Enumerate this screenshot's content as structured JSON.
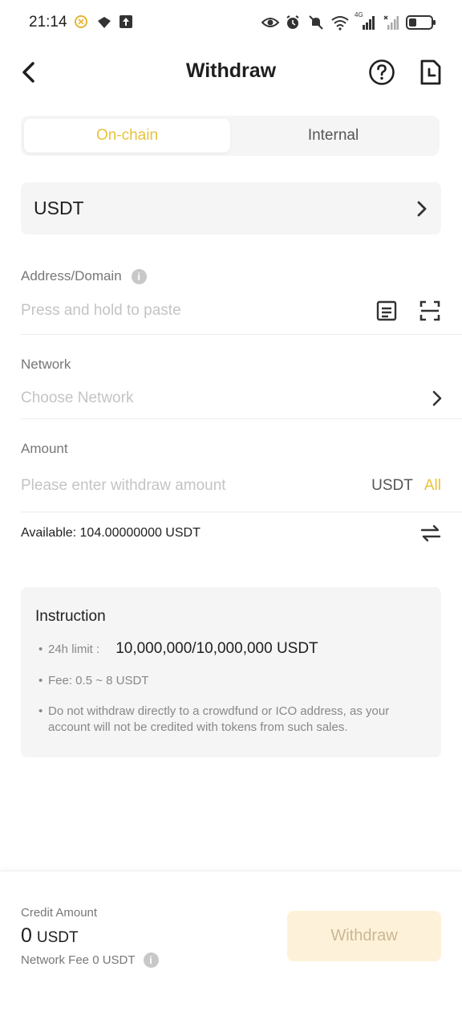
{
  "status_bar": {
    "time": "21:14",
    "network_label": "4G"
  },
  "header": {
    "title": "Withdraw"
  },
  "tabs": [
    {
      "label": "On-chain",
      "active": true
    },
    {
      "label": "Internal",
      "active": false
    }
  ],
  "coin": {
    "symbol": "USDT"
  },
  "address": {
    "label": "Address/Domain",
    "placeholder": "Press and hold to paste"
  },
  "network": {
    "label": "Network",
    "placeholder": "Choose Network"
  },
  "amount": {
    "label": "Amount",
    "placeholder": "Please enter withdraw amount",
    "unit": "USDT",
    "all_label": "All"
  },
  "available": {
    "text": "Available: 104.00000000 USDT"
  },
  "instruction": {
    "title": "Instruction",
    "limit_label": "24h limit :",
    "limit_value": "10,000,000/10,000,000 USDT",
    "fee_text": "Fee: 0.5 ~ 8 USDT",
    "note": "Do not withdraw directly to a crowdfund or ICO address, as your account will not be credited with tokens from such sales.",
    "bullet": "•"
  },
  "bottom": {
    "credit_label": "Credit Amount",
    "credit_amount": "0",
    "credit_unit": "USDT",
    "network_fee": "Network Fee 0 USDT",
    "withdraw_label": "Withdraw"
  },
  "colors": {
    "accent": "#e9c23a",
    "button_bg": "#fdf2d9",
    "button_text": "#c9b793",
    "surface": "#f5f5f5"
  },
  "icons": [
    "back-arrow-icon",
    "help-icon",
    "record-icon",
    "chevron-right-icon",
    "info-icon",
    "paste-icon",
    "scan-icon",
    "swap-icon"
  ]
}
